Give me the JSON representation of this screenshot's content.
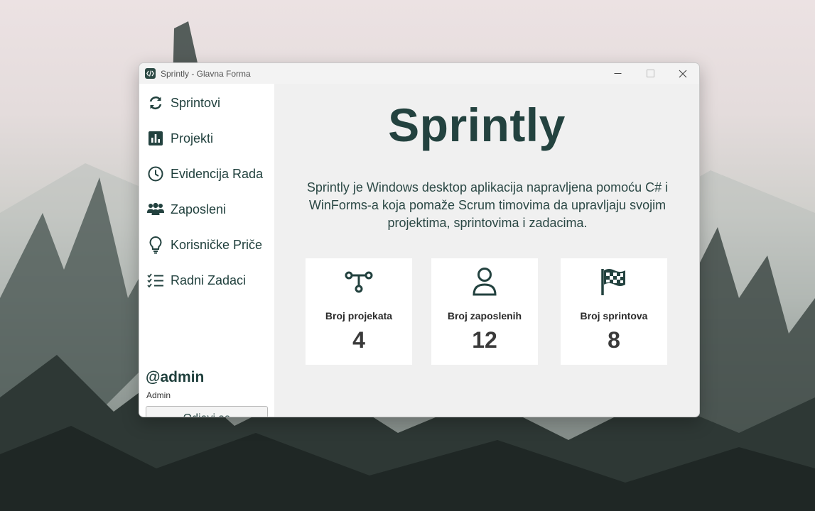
{
  "window": {
    "title": "Sprintly - Glavna Forma"
  },
  "sidebar": {
    "items": [
      {
        "label": "Sprintovi",
        "icon": "sync-icon"
      },
      {
        "label": "Projekti",
        "icon": "bar-chart-icon"
      },
      {
        "label": "Evidencija Rada",
        "icon": "clock-icon"
      },
      {
        "label": "Zaposleni",
        "icon": "users-icon"
      },
      {
        "label": "Korisničke Priče",
        "icon": "lightbulb-icon"
      },
      {
        "label": "Radni Zadaci",
        "icon": "checklist-icon"
      }
    ],
    "user": {
      "handle": "@admin",
      "role": "Admin"
    },
    "logout_label": "Odjavi se"
  },
  "main": {
    "title": "Sprintly",
    "description": "Sprintly je Windows desktop aplikacija napravljena pomoću C# i WinForms-a koja pomaže Scrum timovima da upravljaju svojim projektima, sprintovima i zadacima.",
    "stats": [
      {
        "label": "Broj projekata",
        "value": "4",
        "icon": "network-icon"
      },
      {
        "label": "Broj zaposlenih",
        "value": "12",
        "icon": "user-icon"
      },
      {
        "label": "Broj sprintova",
        "value": "8",
        "icon": "checkered-flag-icon"
      }
    ]
  },
  "colors": {
    "accent": "#23423f",
    "sidebar_bg": "#ffffff",
    "main_bg": "#f0f0f0"
  }
}
